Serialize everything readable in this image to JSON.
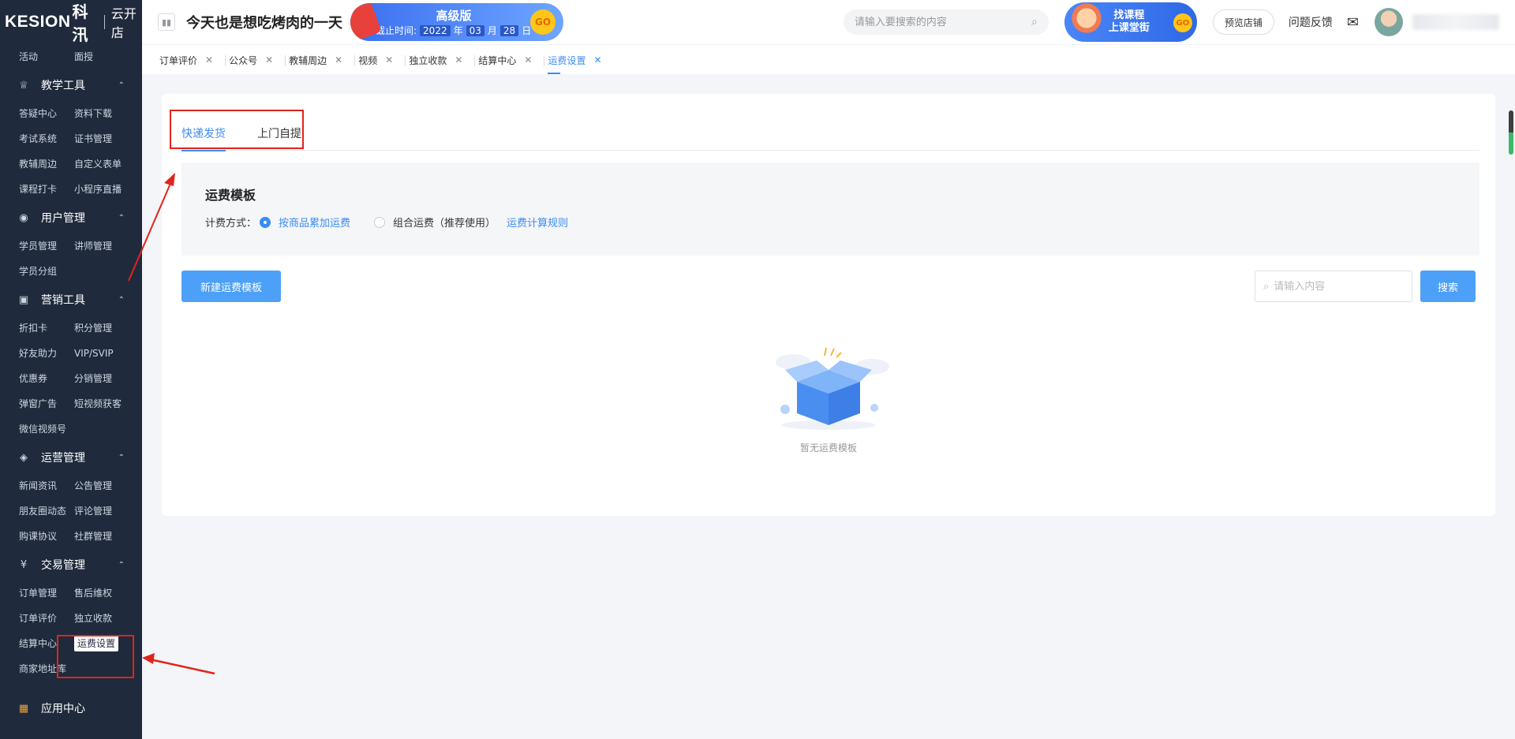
{
  "brand": {
    "logo": "KESION",
    "logo_cn": "科汛",
    "store": "云开店"
  },
  "sidebar": {
    "top_items": [
      "活动",
      "面授"
    ],
    "sections": [
      {
        "title": "教学工具",
        "icon": "trophy-icon",
        "glyph": "♕",
        "items": [
          "答疑中心",
          "资料下载",
          "考试系统",
          "证书管理",
          "教辅周边",
          "自定义表单",
          "课程打卡",
          "小程序直播"
        ]
      },
      {
        "title": "用户管理",
        "icon": "user-circle-icon",
        "glyph": "◉",
        "items": [
          "学员管理",
          "讲师管理",
          "学员分组"
        ]
      },
      {
        "title": "营销工具",
        "icon": "gift-icon",
        "glyph": "▣",
        "items": [
          "折扣卡",
          "积分管理",
          "好友助力",
          "VIP/SVIP",
          "优惠券",
          "分销管理",
          "弹窗广告",
          "短视频获客",
          "微信视频号"
        ]
      },
      {
        "title": "运营管理",
        "icon": "layers-icon",
        "glyph": "◈",
        "items": [
          "新闻资讯",
          "公告管理",
          "朋友圈动态",
          "评论管理",
          "购课协议",
          "社群管理"
        ]
      },
      {
        "title": "交易管理",
        "icon": "yen-circle-icon",
        "glyph": "¥",
        "items": [
          "订单管理",
          "售后维权",
          "订单评价",
          "独立收款",
          "结算中心",
          "运费设置",
          "商家地址库"
        ]
      }
    ],
    "active_item": "运费设置",
    "bottom_section": "应用中心"
  },
  "header": {
    "greeting": "今天也是想吃烤肉的一天",
    "version": {
      "title": "高级版",
      "expiry_label": "截止时间:",
      "year": "2022",
      "year_unit": "年",
      "month": "03",
      "month_unit": "月",
      "day": "28",
      "day_unit": "日",
      "go": "GO"
    },
    "search_placeholder": "请输入要搜索的内容",
    "promo": {
      "line1": "找课程",
      "line2": "上课堂街",
      "go": "GO"
    },
    "preview_store": "预览店铺",
    "feedback": "问题反馈"
  },
  "page_tabs": [
    {
      "label": "订单评价",
      "active": false
    },
    {
      "label": "公众号",
      "active": false
    },
    {
      "label": "教辅周边",
      "active": false
    },
    {
      "label": "视频",
      "active": false
    },
    {
      "label": "独立收款",
      "active": false
    },
    {
      "label": "结算中心",
      "active": false
    },
    {
      "label": "运费设置",
      "active": true
    }
  ],
  "main": {
    "tabs": [
      "快递发货",
      "上门自提"
    ],
    "active_tab": "快递发货",
    "template_title": "运费模板",
    "billing_label": "计费方式：",
    "option_1": "按商品累加运费",
    "option_2": "组合运费（推荐使用）",
    "rule_link": "运费计算规则",
    "new_button": "新建运费模板",
    "search_placeholder": "请输入内容",
    "search_button": "搜索",
    "empty_text": "暂无运费模板"
  },
  "colors": {
    "accent": "#3b8cf5",
    "sidebar": "#1f2a3c",
    "highlight": "#e2231a"
  }
}
